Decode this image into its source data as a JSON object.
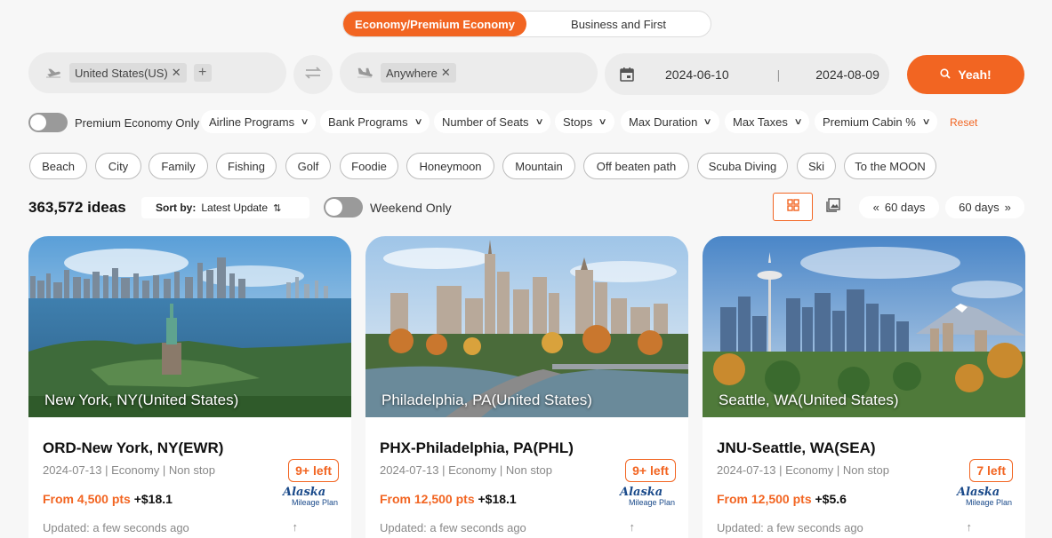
{
  "cabin": {
    "active": "Economy/Premium Economy",
    "inactive": "Business and First"
  },
  "search": {
    "from_tag": "United States(US)",
    "to_tag": "Anywhere",
    "date_start": "2024-06-10",
    "date_sep": "|",
    "date_end": "2024-08-09",
    "button_label": "Yeah!"
  },
  "filters": {
    "premium_toggle_label": "Premium Economy Only",
    "dropdowns": [
      "Airline Programs",
      "Bank Programs",
      "Number of Seats",
      "Stops",
      "Max Duration",
      "Max Taxes",
      "Premium Cabin %"
    ],
    "reset": "Reset"
  },
  "categories": [
    "Beach",
    "City",
    "Family",
    "Fishing",
    "Golf",
    "Foodie",
    "Honeymoon",
    "Mountain",
    "Off beaten path",
    "Scuba Diving",
    "Ski",
    "To the MOON"
  ],
  "results": {
    "count": "363,572 ideas",
    "sort_label": "Sort by:",
    "sort_value": "Latest Update",
    "weekend_label": "Weekend Only",
    "prev_days": "60 days",
    "next_days": "60 days"
  },
  "cards": [
    {
      "caption": "New York, NY(United States)",
      "route": "ORD-New York, NY(EWR)",
      "meta": "2024-07-13 | Economy | Non stop",
      "price_pts": "From 4,500 pts",
      "price_fee": "+$18.1",
      "seats": "9+ left",
      "airline_logo_text": "Alaska",
      "airline_logo_sub": "Mileage Plan",
      "updated": "Updated: a few seconds ago"
    },
    {
      "caption": "Philadelphia, PA(United States)",
      "route": "PHX-Philadelphia, PA(PHL)",
      "meta": "2024-07-13 | Economy | Non stop",
      "price_pts": "From 12,500 pts",
      "price_fee": "+$18.1",
      "seats": "9+ left",
      "airline_logo_text": "Alaska",
      "airline_logo_sub": "Mileage Plan",
      "updated": "Updated: a few seconds ago"
    },
    {
      "caption": "Seattle, WA(United States)",
      "route": "JNU-Seattle, WA(SEA)",
      "meta": "2024-07-13 | Economy | Non stop",
      "price_pts": "From 12,500 pts",
      "price_fee": "+$5.6",
      "seats": "7 left",
      "airline_logo_text": "Alaska",
      "airline_logo_sub": "Mileage Plan",
      "updated": "Updated: a few seconds ago"
    }
  ],
  "colors": {
    "accent": "#f26522",
    "background": "#f7f7f7",
    "field": "#ececec"
  },
  "icons": [
    "plane-takeoff-icon",
    "plane-landing-icon",
    "swap-icon",
    "calendar-icon",
    "search-icon",
    "sort-icon",
    "grid-view-icon",
    "image-view-icon",
    "chevron-left-icon",
    "chevron-right-icon",
    "arrow-up-icon"
  ]
}
